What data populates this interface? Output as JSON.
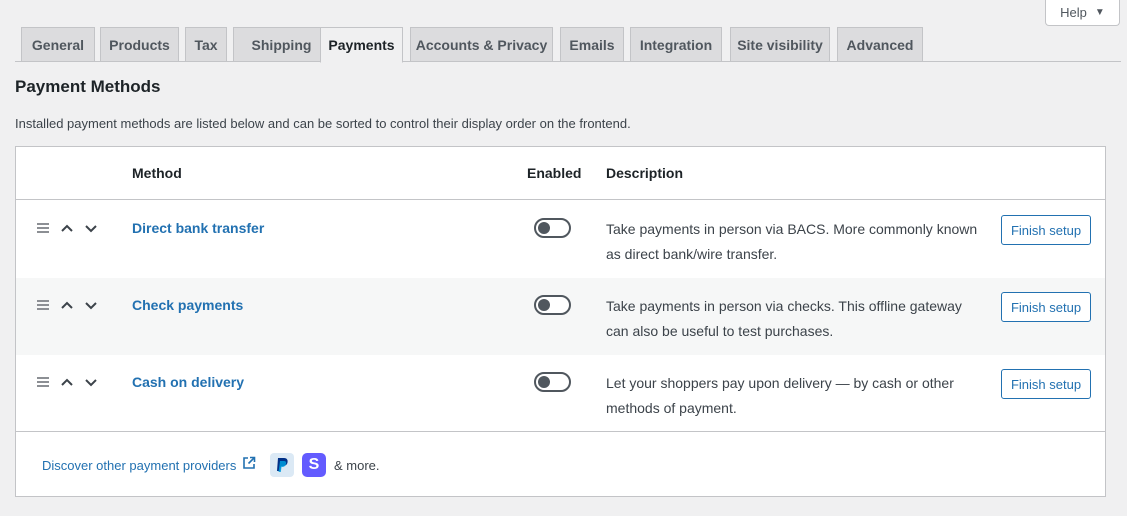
{
  "help": {
    "label": "Help",
    "caret": "▼"
  },
  "tabs": [
    {
      "label": "General"
    },
    {
      "label": "Products"
    },
    {
      "label": "Tax"
    },
    {
      "label": "Shipping"
    },
    {
      "label": "Payments",
      "active": true
    },
    {
      "label": "Accounts & Privacy"
    },
    {
      "label": "Emails"
    },
    {
      "label": "Integration"
    },
    {
      "label": "Site visibility"
    },
    {
      "label": "Advanced"
    }
  ],
  "page": {
    "title": "Payment Methods",
    "intro": "Installed payment methods are listed below and can be sorted to control their display order on the frontend."
  },
  "table": {
    "headers": {
      "method": "Method",
      "enabled": "Enabled",
      "description": "Description"
    },
    "rows": [
      {
        "method": "Direct bank transfer",
        "enabled": false,
        "description_lines": [
          "Take payments in person via BACS. More commonly known",
          "as direct bank/wire transfer."
        ],
        "action": "Finish setup"
      },
      {
        "method": "Check payments",
        "enabled": false,
        "description_lines": [
          "Take payments in person via checks. This offline gateway",
          "can also be useful to test purchases."
        ],
        "action": "Finish setup"
      },
      {
        "method": "Cash on delivery",
        "enabled": false,
        "description_lines": [
          "Let your shoppers pay upon delivery — by cash or other",
          "methods of payment."
        ],
        "action": "Finish setup"
      }
    ],
    "footer": {
      "discover_label": "Discover other payment providers",
      "more_label": "& more.",
      "paypal_text": "PayPal",
      "stripe_text": "S"
    }
  },
  "colors": {
    "accent": "#2271b1",
    "background": "#f0f0f1",
    "stripe": "#635bff"
  }
}
